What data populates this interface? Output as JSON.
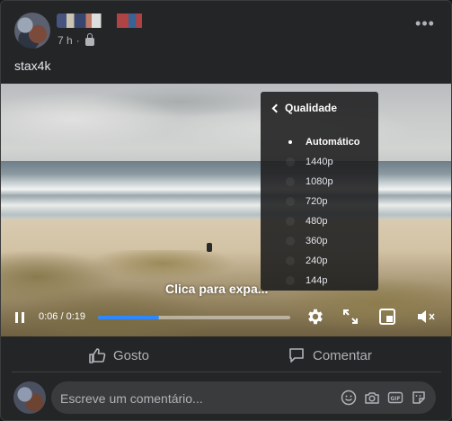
{
  "post": {
    "time": "7 h",
    "caption": "stax4k",
    "more_label": "•••"
  },
  "video": {
    "overlay_text": "Clica para expa...",
    "time_display": "0:06 / 0:19",
    "progress_fraction": 0.32,
    "quality_menu": {
      "title": "Qualidade",
      "options": [
        "Automático",
        "1440p",
        "1080p",
        "720p",
        "480p",
        "360p",
        "240p",
        "144p"
      ],
      "selected": "Automático"
    }
  },
  "actions": {
    "like_label": "Gosto",
    "comment_label": "Comentar"
  },
  "composer": {
    "placeholder": "Escreve um comentário..."
  },
  "colors": {
    "background": "#242526",
    "progress": "#2d88ff",
    "text_secondary": "#b0b3b8"
  }
}
